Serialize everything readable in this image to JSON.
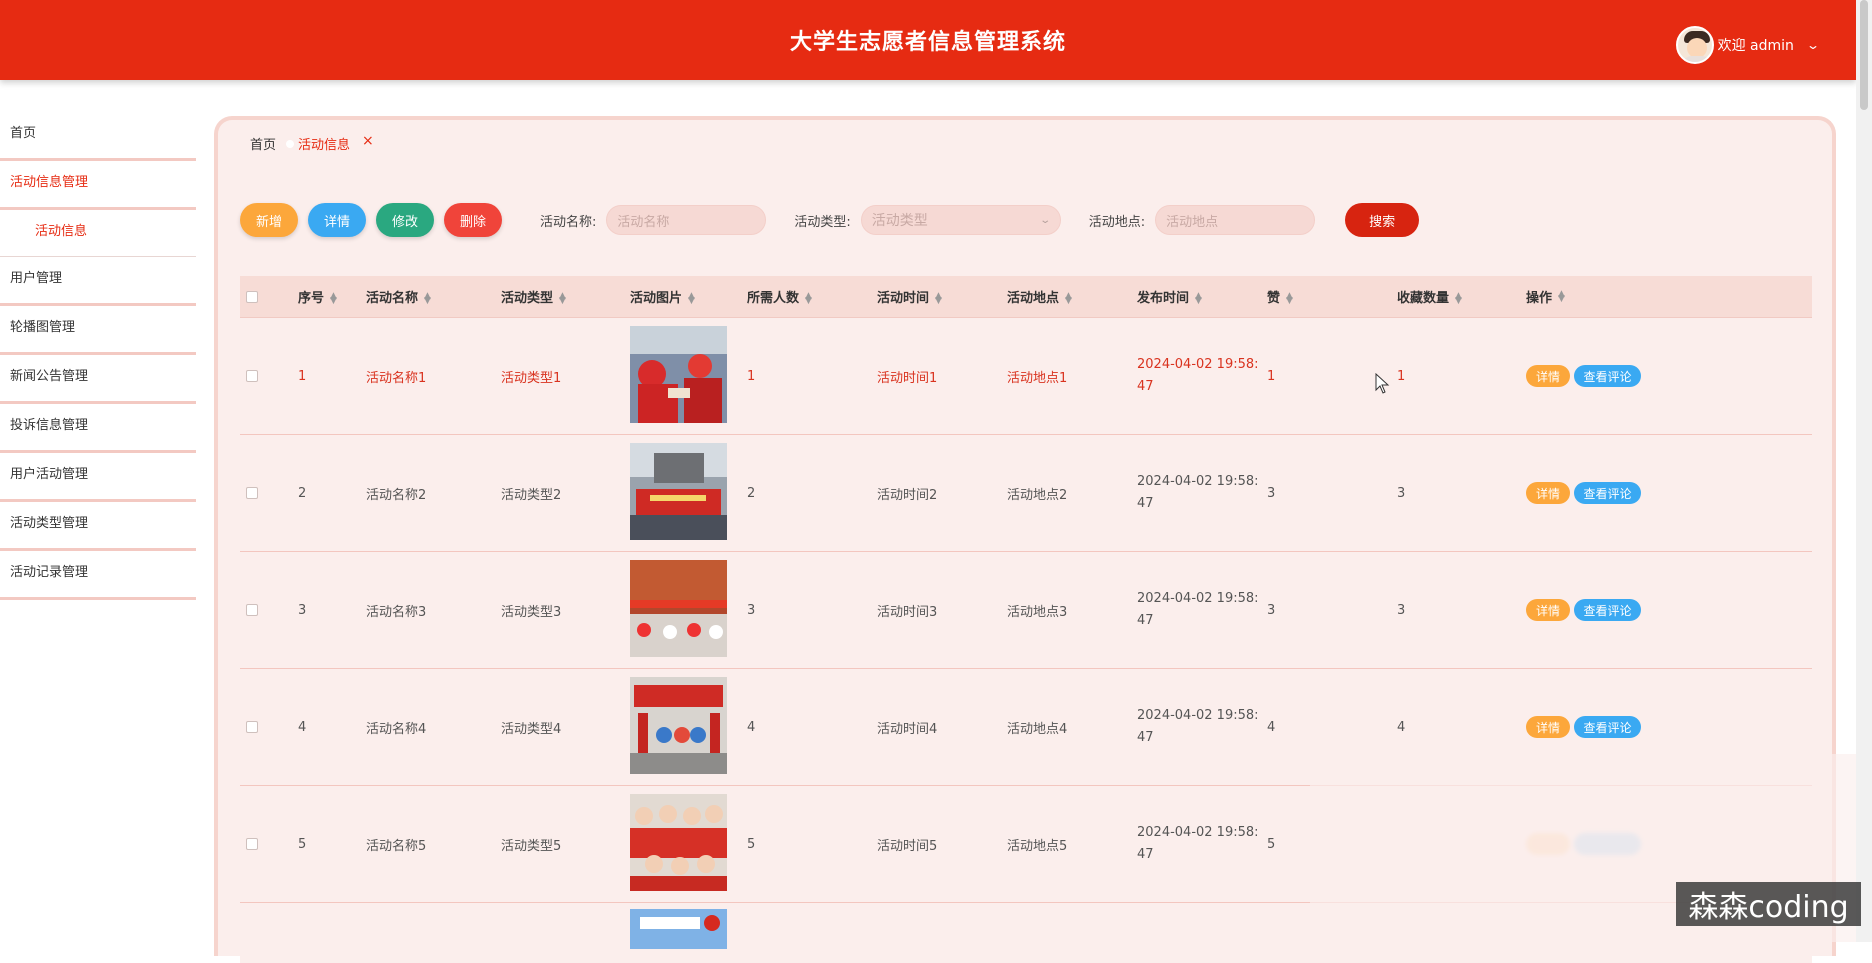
{
  "header": {
    "title": "大学生志愿者信息管理系统",
    "user_label": "欢迎 admin"
  },
  "sidebar": {
    "items": [
      {
        "label": "首页"
      },
      {
        "label": "活动信息管理"
      },
      {
        "label": "活动信息"
      },
      {
        "label": "用户管理"
      },
      {
        "label": "轮播图管理"
      },
      {
        "label": "新闻公告管理"
      },
      {
        "label": "投诉信息管理"
      },
      {
        "label": "用户活动管理"
      },
      {
        "label": "活动类型管理"
      },
      {
        "label": "活动记录管理"
      }
    ]
  },
  "tabs": {
    "home": "首页",
    "current": "活动信息",
    "close": "×"
  },
  "toolbar": {
    "add": "新增",
    "detail": "详情",
    "edit": "修改",
    "delete": "删除",
    "name_label": "活动名称:",
    "name_placeholder": "活动名称",
    "type_label": "活动类型:",
    "type_placeholder": "活动类型",
    "place_label": "活动地点:",
    "place_placeholder": "活动地点",
    "search": "搜索"
  },
  "table": {
    "headers": [
      "序号",
      "活动名称",
      "活动类型",
      "活动图片",
      "所需人数",
      "活动时间",
      "活动地点",
      "发布时间",
      "赞",
      "收藏数量",
      "操作"
    ],
    "op_detail": "详情",
    "op_comment": "查看评论",
    "rows": [
      {
        "id": "1",
        "name": "活动名称1",
        "type": "活动类型1",
        "people": "1",
        "time": "活动时间1",
        "place": "活动地点1",
        "pub": "2024-04-02 19:58:47",
        "likes": "1",
        "fav": "1"
      },
      {
        "id": "2",
        "name": "活动名称2",
        "type": "活动类型2",
        "people": "2",
        "time": "活动时间2",
        "place": "活动地点2",
        "pub": "2024-04-02 19:58:47",
        "likes": "3",
        "fav": "3"
      },
      {
        "id": "3",
        "name": "活动名称3",
        "type": "活动类型3",
        "people": "3",
        "time": "活动时间3",
        "place": "活动地点3",
        "pub": "2024-04-02 19:58:47",
        "likes": "3",
        "fav": "3"
      },
      {
        "id": "4",
        "name": "活动名称4",
        "type": "活动类型4",
        "people": "4",
        "time": "活动时间4",
        "place": "活动地点4",
        "pub": "2024-04-02 19:58:47",
        "likes": "4",
        "fav": "4"
      },
      {
        "id": "5",
        "name": "活动名称5",
        "type": "活动类型5",
        "people": "5",
        "time": "活动时间5",
        "place": "活动地点5",
        "pub": "2024-04-02 19:58:47",
        "likes": "5",
        "fav": ""
      }
    ]
  },
  "watermark": "森森coding",
  "colors": {
    "primary": "#e62b12",
    "panel": "#fbeeec",
    "orange": "#fca73b",
    "blue": "#3aa9f2",
    "green": "#2aa880",
    "red": "#f0443a"
  }
}
